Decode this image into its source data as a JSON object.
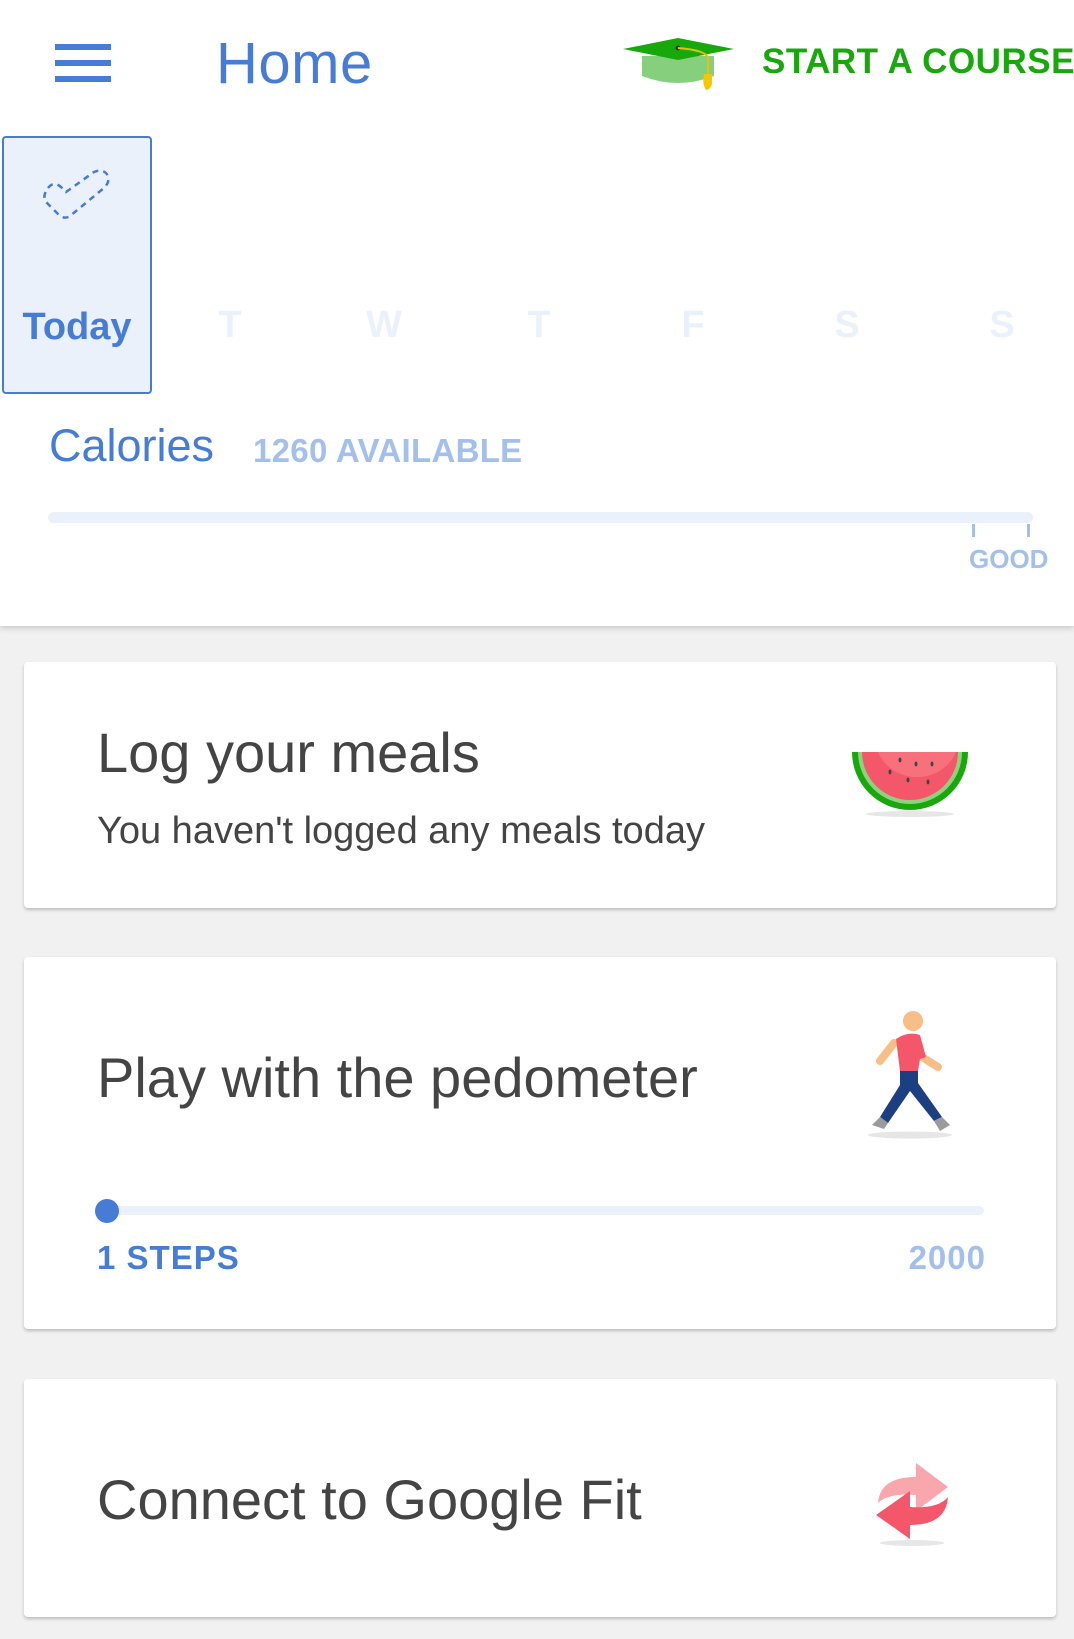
{
  "header": {
    "title": "Home",
    "course_button_label": "START A COURSE"
  },
  "days": {
    "today_label": "Today",
    "others": [
      "T",
      "W",
      "T",
      "F",
      "S",
      "S"
    ]
  },
  "calories": {
    "title": "Calories",
    "available_text": "1260 AVAILABLE",
    "progress_percent": 0,
    "good_label": "GOOD"
  },
  "cards": {
    "meals": {
      "title": "Log your meals",
      "subtitle": "You haven't logged any meals today"
    },
    "pedometer": {
      "title": "Play with the pedometer",
      "steps_label": "1 STEPS",
      "goal_label": "2000",
      "steps": 1,
      "goal": 2000
    },
    "google_fit": {
      "title": "Connect to Google Fit"
    }
  },
  "colors": {
    "accent": "#467bd6",
    "accent_light": "#a3bfec",
    "track": "#ebf1fb",
    "course_green": "#18a80b",
    "text": "#444444",
    "background": "#f1f1f1"
  }
}
